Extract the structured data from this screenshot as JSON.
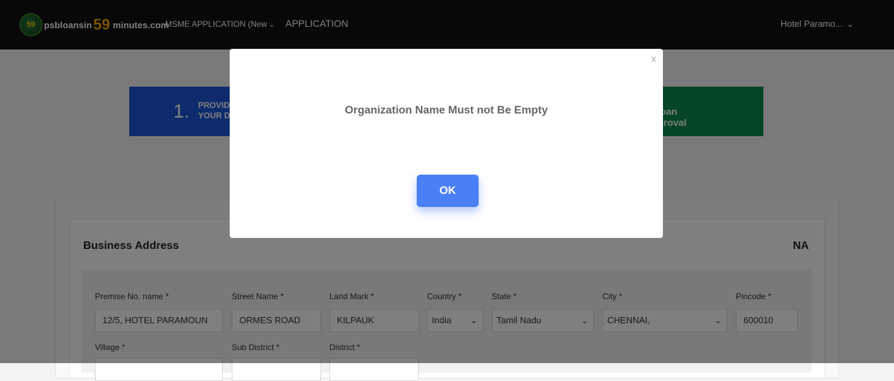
{
  "nav": {
    "logo": {
      "badge": "59",
      "text_before": "psbloansin",
      "text_num": "59",
      "text_after": "minutes.com"
    },
    "msme_label": "MSME APPLICATION (New",
    "application_label": "APPLICATION",
    "user_label": "Hotel Paramo...",
    "chevron": "⌄"
  },
  "steps": {
    "first": {
      "number": "1.",
      "text_line1": "PROVID",
      "text_line2": "YOUR D"
    },
    "last": {
      "check": "✓",
      "label_line1": "Loan",
      "label_line2": "Approval"
    }
  },
  "section": {
    "title": "Business Address",
    "na": "NA"
  },
  "form": {
    "premise": {
      "label": "Premise No. name *",
      "value": "12/5, HOTEL PARAMOUN"
    },
    "street": {
      "label": "Street Name *",
      "value": "ORMES ROAD"
    },
    "landmark": {
      "label": "Land Mark *",
      "value": "KILPAUK"
    },
    "country": {
      "label": "Country *",
      "value": "India"
    },
    "state": {
      "label": "State *",
      "value": "Tamil Nadu"
    },
    "city": {
      "label": "City *",
      "value": "CHENNAI,"
    },
    "pincode": {
      "label": "Pincode *",
      "value": "600010"
    },
    "village": {
      "label": "Village *"
    },
    "subdistrict": {
      "label": "Sub District *"
    },
    "district": {
      "label": "District *"
    }
  },
  "modal": {
    "close": "x",
    "message": "Organization Name Must not Be Empty",
    "ok_label": "OK"
  },
  "colors": {
    "step_blue": "#1a56db",
    "step_green": "#0d8a4c",
    "ok_button": "#4a80f5",
    "logo_accent": "#f5a300"
  }
}
